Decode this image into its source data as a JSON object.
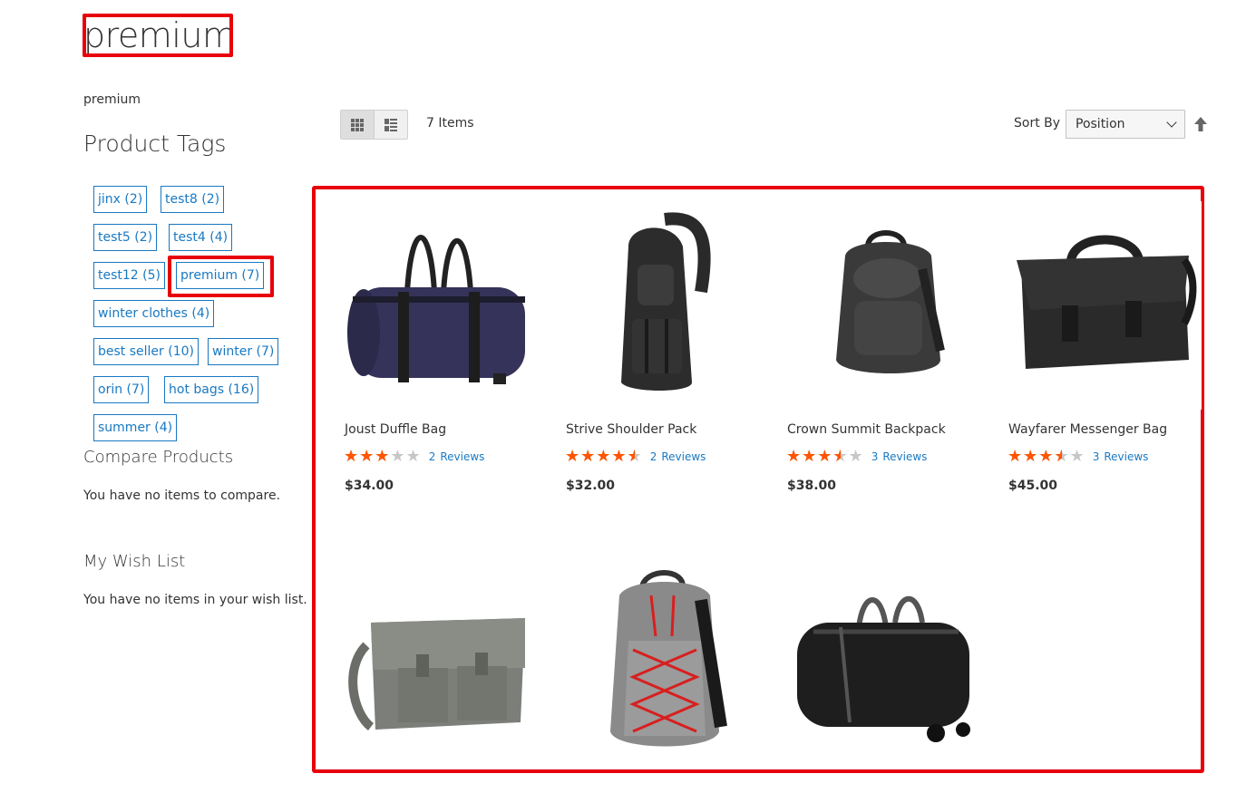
{
  "page": {
    "title": "premium",
    "description": "premium"
  },
  "sidebar": {
    "tags_heading": "Product Tags",
    "tags": [
      {
        "label": "jinx (2)"
      },
      {
        "label": "test8 (2)"
      },
      {
        "label": "test5 (2)"
      },
      {
        "label": "test4 (4)"
      },
      {
        "label": "test12 (5)"
      },
      {
        "label": "premium (7)"
      },
      {
        "label": "winter clothes (4)"
      },
      {
        "label": "best seller (10)"
      },
      {
        "label": "winter (7)"
      },
      {
        "label": "orin (7)"
      },
      {
        "label": "hot bags (16)"
      },
      {
        "label": "summer (4)"
      }
    ],
    "compare": {
      "heading": "Compare Products",
      "empty_text": "You have no items to compare."
    },
    "wishlist": {
      "heading": "My Wish List",
      "empty_text": "You have no items in your wish list."
    }
  },
  "toolbar": {
    "items_count": "7 Items",
    "sort_label": "Sort By",
    "sort_value": "Position",
    "view_modes": [
      "grid-icon",
      "list-icon"
    ]
  },
  "products": [
    {
      "name": "Joust Duffle Bag",
      "rating": 0.6,
      "reviews_count": "2",
      "reviews_label": "Reviews",
      "price": "$34.00",
      "icon": "duffle-bag-image",
      "color": "#35335a"
    },
    {
      "name": "Strive Shoulder Pack",
      "rating": 0.9,
      "reviews_count": "2",
      "reviews_label": "Reviews",
      "price": "$32.00",
      "icon": "shoulder-pack-image",
      "color": "#2c2c2c"
    },
    {
      "name": "Crown Summit Backpack",
      "rating": 0.7,
      "reviews_count": "3",
      "reviews_label": "Reviews",
      "price": "$38.00",
      "icon": "backpack-image",
      "color": "#3a3a3a"
    },
    {
      "name": "Wayfarer Messenger Bag",
      "rating": 0.7,
      "reviews_count": "3",
      "reviews_label": "Reviews",
      "price": "$45.00",
      "icon": "messenger-bag-image",
      "color": "#2a2a2a"
    },
    {
      "icon": "canvas-messenger-image",
      "color": "#7c7f79"
    },
    {
      "icon": "red-laced-backpack-image",
      "color": "#8a8a8a"
    },
    {
      "icon": "rolling-duffle-image",
      "color": "#1e1e1e"
    }
  ],
  "colors": {
    "link": "#1979c3",
    "star": "#ff5501",
    "highlight": "#e8000b"
  }
}
